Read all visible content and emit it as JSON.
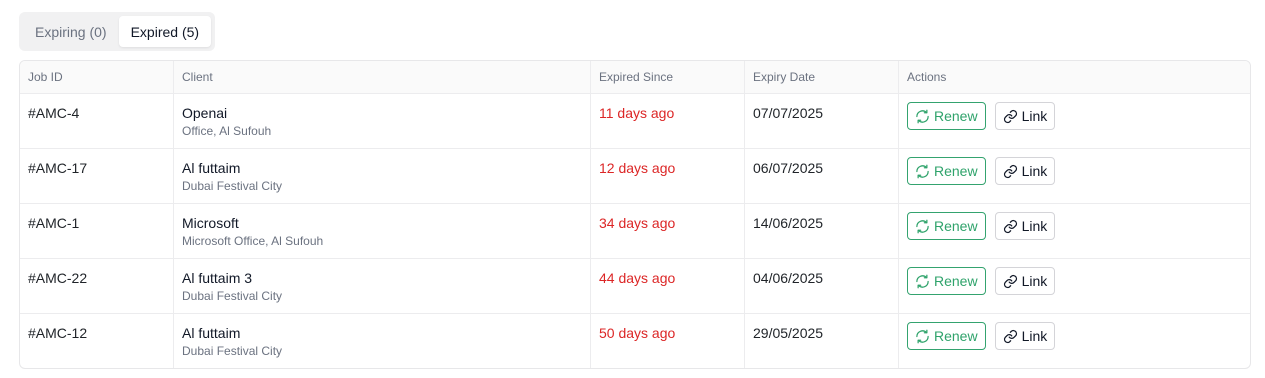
{
  "tabs": [
    {
      "label": "Expiring (0)",
      "active": false
    },
    {
      "label": "Expired (5)",
      "active": true
    }
  ],
  "table": {
    "headers": [
      "Job ID",
      "Client",
      "Expired Since",
      "Expiry Date",
      "Actions"
    ],
    "rows": [
      {
        "job_id": "#AMC-4",
        "client": "Openai",
        "location": "Office, Al Sufouh",
        "expired_since": "11 days ago",
        "expiry_date": "07/07/2025"
      },
      {
        "job_id": "#AMC-17",
        "client": "Al futtaim",
        "location": "Dubai Festival City",
        "expired_since": "12 days ago",
        "expiry_date": "06/07/2025"
      },
      {
        "job_id": "#AMC-1",
        "client": "Microsoft",
        "location": "Microsoft Office, Al Sufouh",
        "expired_since": "34 days ago",
        "expiry_date": "14/06/2025"
      },
      {
        "job_id": "#AMC-22",
        "client": "Al futtaim 3",
        "location": "Dubai Festival City",
        "expired_since": "44 days ago",
        "expiry_date": "04/06/2025"
      },
      {
        "job_id": "#AMC-12",
        "client": "Al futtaim",
        "location": "Dubai Festival City",
        "expired_since": "50 days ago",
        "expiry_date": "29/05/2025"
      }
    ]
  },
  "actions": {
    "renew_label": "Renew",
    "link_label": "Link",
    "renew_icon": "refresh-icon",
    "link_icon": "link-icon"
  },
  "colors": {
    "expired_text": "#dc2626",
    "renew_accent": "#2fa36b"
  }
}
